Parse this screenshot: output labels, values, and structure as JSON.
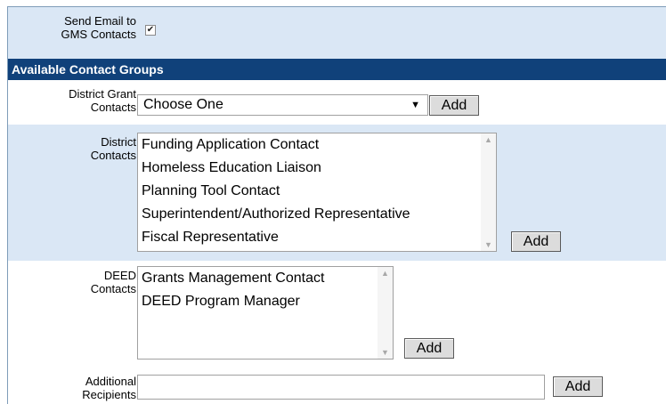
{
  "send_email": {
    "label_line1": "Send Email to",
    "label_line2": "GMS Contacts",
    "checked_mark": "✔"
  },
  "section_header": "Available Contact Groups",
  "district_grant": {
    "label_line1": "District Grant",
    "label_line2": "Contacts",
    "selected": "Choose One",
    "arrow": "▼",
    "add_label": "Add"
  },
  "district_contacts": {
    "label_line1": "District",
    "label_line2": "Contacts",
    "items": [
      "Funding Application Contact",
      "Homeless Education Liaison",
      "Planning Tool Contact",
      "Superintendent/Authorized Representative",
      "Fiscal Representative"
    ],
    "add_label": "Add"
  },
  "deed_contacts": {
    "label_line1": "DEED",
    "label_line2": "Contacts",
    "items": [
      "Grants Management Contact",
      "DEED Program Manager"
    ],
    "add_label": "Add"
  },
  "additional": {
    "label_line1": "Additional",
    "label_line2": "Recipients",
    "value": "",
    "add_label": "Add"
  },
  "scroll_up_glyph": "▲",
  "scroll_down_glyph": "▼",
  "colors": {
    "header_bg": "#10417a",
    "row_blue": "#dae7f5",
    "border": "#7f9db9"
  }
}
